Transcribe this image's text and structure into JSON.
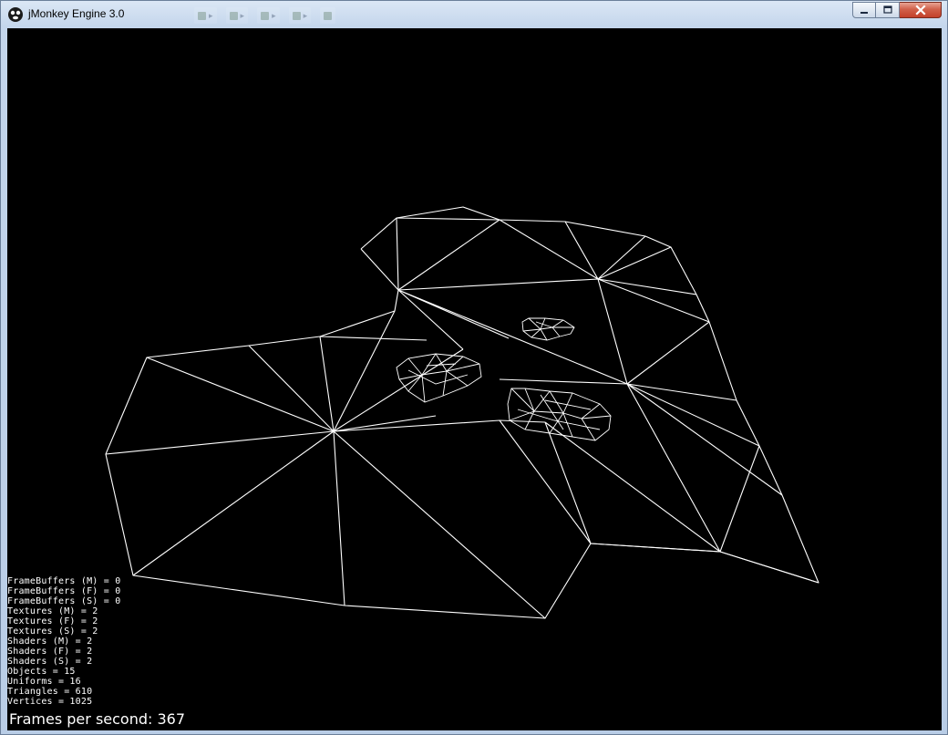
{
  "window": {
    "title": "jMonkey Engine 3.0",
    "controls": {
      "minimize_icon": "minimize-icon",
      "maximize_icon": "maximize-icon",
      "close_icon": "close-icon"
    },
    "close_color": "#c7432c"
  },
  "viewport": {
    "background": "#000000",
    "wire_color": "#ffffff",
    "stats": [
      "FrameBuffers (M) = 0",
      "FrameBuffers (F) = 0",
      "FrameBuffers (S) = 0",
      "Textures (M) = 2",
      "Textures (F) = 2",
      "Textures (S) = 2",
      "Shaders (M) = 2",
      "Shaders (F) = 2",
      "Shaders (S) = 2",
      "Objects = 15",
      "Uniforms = 16",
      "Triangles = 610",
      "Vertices = 1025"
    ],
    "fps_label": "Frames per second: 367"
  }
}
